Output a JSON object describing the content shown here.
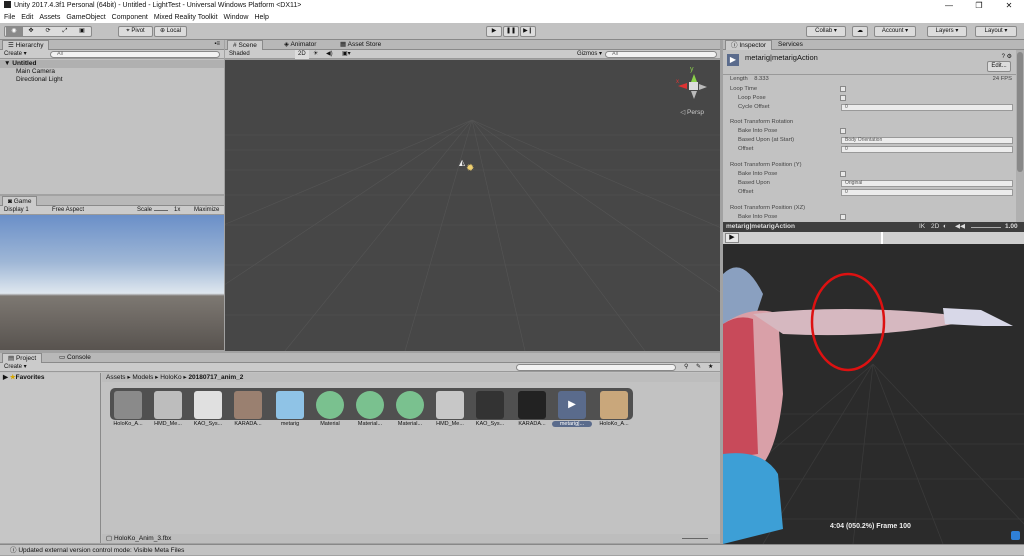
{
  "window": {
    "title": "Unity 2017.4.3f1 Personal (64bit) - Untitled - LightTest - Universal Windows Platform <DX11>",
    "minimize": "—",
    "maximize": "❐",
    "close": "✕"
  },
  "menu": [
    "File",
    "Edit",
    "Assets",
    "GameObject",
    "Component",
    "Mixed Reality Toolkit",
    "Window",
    "Help"
  ],
  "toolbar": {
    "pivot": "Pivot",
    "local": "Local",
    "play": "▶",
    "pause": "❚❚",
    "step": "▶❙",
    "collab": "Collab ▾",
    "cloud": "☁",
    "account": "Account ▾",
    "layers": "Layers ▾",
    "layout": "Layout ▾"
  },
  "hierarchy": {
    "tab": "Hierarchy",
    "create": "Create ▾",
    "search": "All",
    "scene": "Untitled",
    "items": [
      "Main Camera",
      "Directional Light"
    ]
  },
  "scene": {
    "tabs": [
      "Scene",
      "Animator",
      "Asset Store"
    ],
    "shading": "Shaded",
    "mode2d": "2D",
    "gizmos": "Gizmos ▾",
    "search": "All",
    "persp": "Persp",
    "gizmo_y": "y",
    "gizmo_x": "x"
  },
  "game": {
    "tab": "Game",
    "display": "Display 1",
    "aspect": "Free Aspect",
    "scale_label": "Scale",
    "scale_value": "1x",
    "maximize": "Maximize"
  },
  "project": {
    "tabs": [
      "Project",
      "Console"
    ],
    "create": "Create ▾",
    "favorites": "Favorites",
    "breadcrumb": [
      "Assets",
      "Models",
      "HoloKo",
      "20180717_anim_2"
    ],
    "footer_file": "HoloKo_Anim_3.fbx",
    "assets": [
      {
        "label": "HoloKo_A...",
        "color": "#8a8a8a"
      },
      {
        "label": "HMD_Me...",
        "color": "#bdbdbd"
      },
      {
        "label": "KAO_Sys...",
        "color": "#e0e0e0"
      },
      {
        "label": "KARADA...",
        "color": "#9a8070"
      },
      {
        "label": "metarig",
        "color": "#8fc3e6"
      },
      {
        "label": "Material",
        "color": "#7ac18f"
      },
      {
        "label": "Material...",
        "color": "#7ac18f"
      },
      {
        "label": "Material...",
        "color": "#7ac18f"
      },
      {
        "label": "HMD_Me...",
        "color": "#c7c7c7"
      },
      {
        "label": "KAO_Sys...",
        "color": "#333333"
      },
      {
        "label": "KARADA...",
        "color": "#222222"
      },
      {
        "label": "metarig|...",
        "color": "#5a6b8c"
      },
      {
        "label": "HoloKo_A...",
        "color": "#c9a77b"
      }
    ]
  },
  "inspector": {
    "tabs": [
      "Inspector",
      "Services"
    ],
    "object": "metarig|metarigAction",
    "edit": "Edit...",
    "length_label": "Length",
    "length_value": "8.333",
    "fps": "24 FPS",
    "loop_time": "Loop Time",
    "loop_pose": "Loop Pose",
    "cycle_offset": "Cycle Offset",
    "cycle_value": "0",
    "rot_header": "Root Transform Rotation",
    "bake_pose": "Bake Into Pose",
    "based_upon_start": "Based Upon (at Start)",
    "body_orientation": "Body Orientation",
    "offset": "Offset",
    "offset_value": "0",
    "posy_header": "Root Transform Position (Y)",
    "based_upon": "Based Upon",
    "original": "Original",
    "posxz_header": "Root Transform Position (XZ)"
  },
  "preview": {
    "title": "metarig|metarigAction",
    "ik": "IK",
    "mode2d": "2D",
    "speed": "1.00",
    "play": "▶",
    "frame_info": "4:04 (050.2%) Frame 100"
  },
  "status": {
    "text": "Updated external version control mode: Visible Meta Files"
  }
}
